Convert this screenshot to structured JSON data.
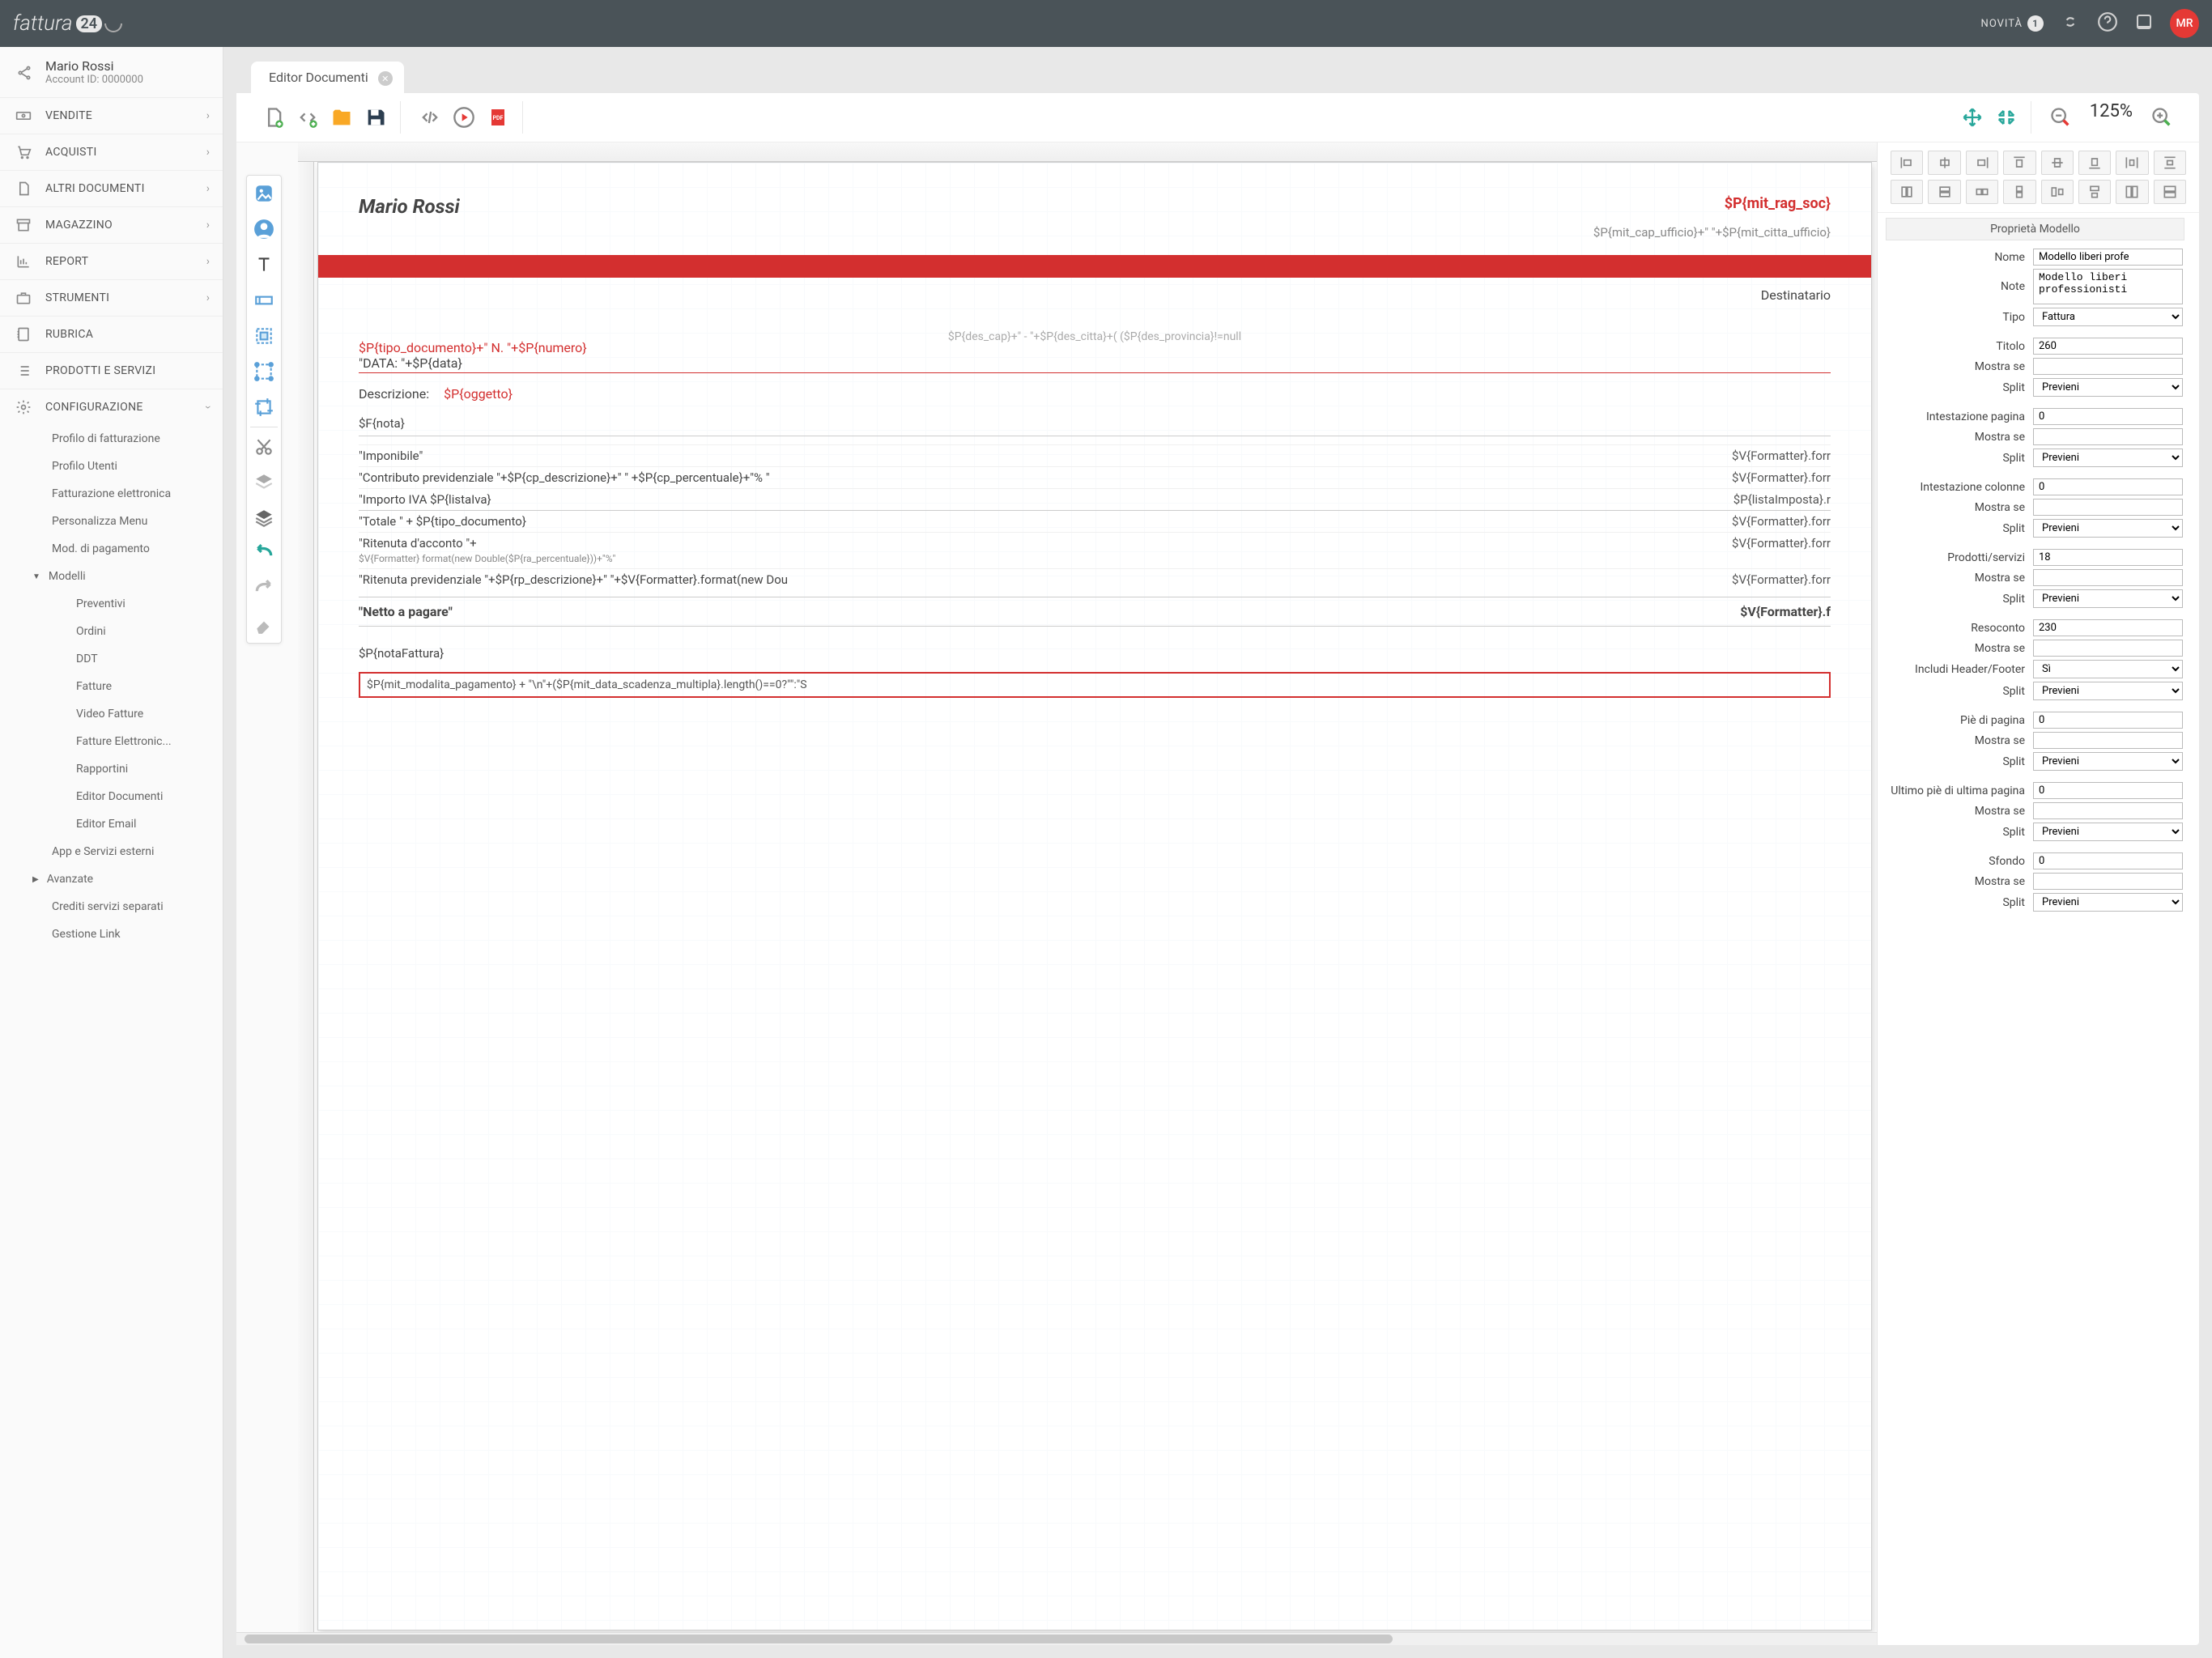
{
  "brand": {
    "name": "fattura",
    "badge": "24"
  },
  "topbar": {
    "novita": "NOVITÀ",
    "novita_count": "1",
    "avatar": "MR"
  },
  "user": {
    "name": "Mario Rossi",
    "account": "Account ID: 0000000"
  },
  "nav": {
    "vendite": "VENDITE",
    "acquisti": "ACQUISTI",
    "altri": "ALTRI DOCUMENTI",
    "magazzino": "MAGAZZINO",
    "report": "REPORT",
    "strumenti": "STRUMENTI",
    "rubrica": "RUBRICA",
    "prodotti": "PRODOTTI E SERVIZI",
    "config": "CONFIGURAZIONE"
  },
  "subnav": {
    "profilo_fatt": "Profilo di fatturazione",
    "profilo_utenti": "Profilo Utenti",
    "fatt_elettr": "Fatturazione elettronica",
    "personalizza": "Personalizza Menu",
    "mod_pagamento": "Mod. di pagamento",
    "modelli": "Modelli",
    "preventivi": "Preventivi",
    "ordini": "Ordini",
    "ddt": "DDT",
    "fatture": "Fatture",
    "video_fatture": "Video Fatture",
    "fatture_elettr": "Fatture Elettronic...",
    "rapportini": "Rapportini",
    "editor_doc": "Editor Documenti",
    "editor_email": "Editor Email",
    "app_servizi": "App e Servizi esterni",
    "avanzate": "Avanzate",
    "crediti": "Crediti servizi separati",
    "gestione_link": "Gestione Link"
  },
  "tab": {
    "title": "Editor Documenti"
  },
  "zoom": "125%",
  "doc": {
    "name": "Mario Rossi",
    "mit_rag": "$P{mit_rag_soc}",
    "mit_cap": "$P{mit_cap_ufficio}+\" \"+$P{mit_citta_ufficio}",
    "dest": "Destinatario",
    "des_cap": "$P{des_cap}+\" - \"+$P{des_citta}+( ($P{des_provincia}!=null",
    "tipo": "$P{tipo_documento}+\" N. \"+$P{numero}",
    "data": "\"DATA: \"+$P{data}",
    "descr_label": "Descrizione:",
    "oggetto": "$P{oggetto}",
    "nota": "$F{nota}",
    "imponibile_l": "\"Imponibile\"",
    "imponibile_r": "$V{Formatter}.forr",
    "contributo_l": "\"Contributo previdenziale \"+$P{cp_descrizione}+\" \" +$P{cp_percentuale}+\"% \"",
    "contributo_r": "$V{Formatter}.forr",
    "importo_l": "\"Importo IVA  $P{listaIva}",
    "importo_r": "$P{listaImposta}.r",
    "totale_l": "\"Totale \" + $P{tipo_documento}",
    "totale_r": "$V{Formatter}.forr",
    "rit_acc_l1": "\"Ritenuta d'acconto \"+",
    "rit_acc_l2": "$V{Formatter} format(new Double($P{ra_percentuale}))+\"%\"",
    "rit_acc_r": "$V{Formatter}.forr",
    "rit_prev_l": "\"Ritenuta previdenziale \"+$P{rp_descrizione}+\" \"+$V{Formatter}.format(new Dou",
    "rit_prev_r": "$V{Formatter}.forr",
    "netto_l": "\"Netto a pagare\"",
    "netto_r": "$V{Formatter}.f",
    "nota_fatt": "$P{notaFattura}",
    "pay": "$P{mit_modalita_pagamento} + \"\\n\"+($P{mit_data_scadenza_multipla}.length()==0?\"\":\"S"
  },
  "props": {
    "header": "Proprietà Modello",
    "nome_l": "Nome",
    "nome_v": "Modello liberi profe",
    "note_l": "Note",
    "note_v": "Modello liberi professionisti",
    "tipo_l": "Tipo",
    "tipo_v": "Fattura",
    "titolo_l": "Titolo",
    "titolo_v": "260",
    "mostra_l": "Mostra se",
    "split_l": "Split",
    "split_v": "Previeni",
    "int_pag_l": "Intestazione pagina",
    "int_pag_v": "0",
    "int_col_l": "Intestazione colonne",
    "int_col_v": "0",
    "prod_l": "Prodotti/servizi",
    "prod_v": "18",
    "res_l": "Resoconto",
    "res_v": "230",
    "inc_hf_l": "Includi Header/Footer",
    "inc_hf_v": "Sì",
    "pie_l": "Piè di pagina",
    "pie_v": "0",
    "ult_l": "Ultimo piè di ultima pagina",
    "ult_v": "0",
    "sfondo_l": "Sfondo",
    "sfondo_v": "0"
  }
}
